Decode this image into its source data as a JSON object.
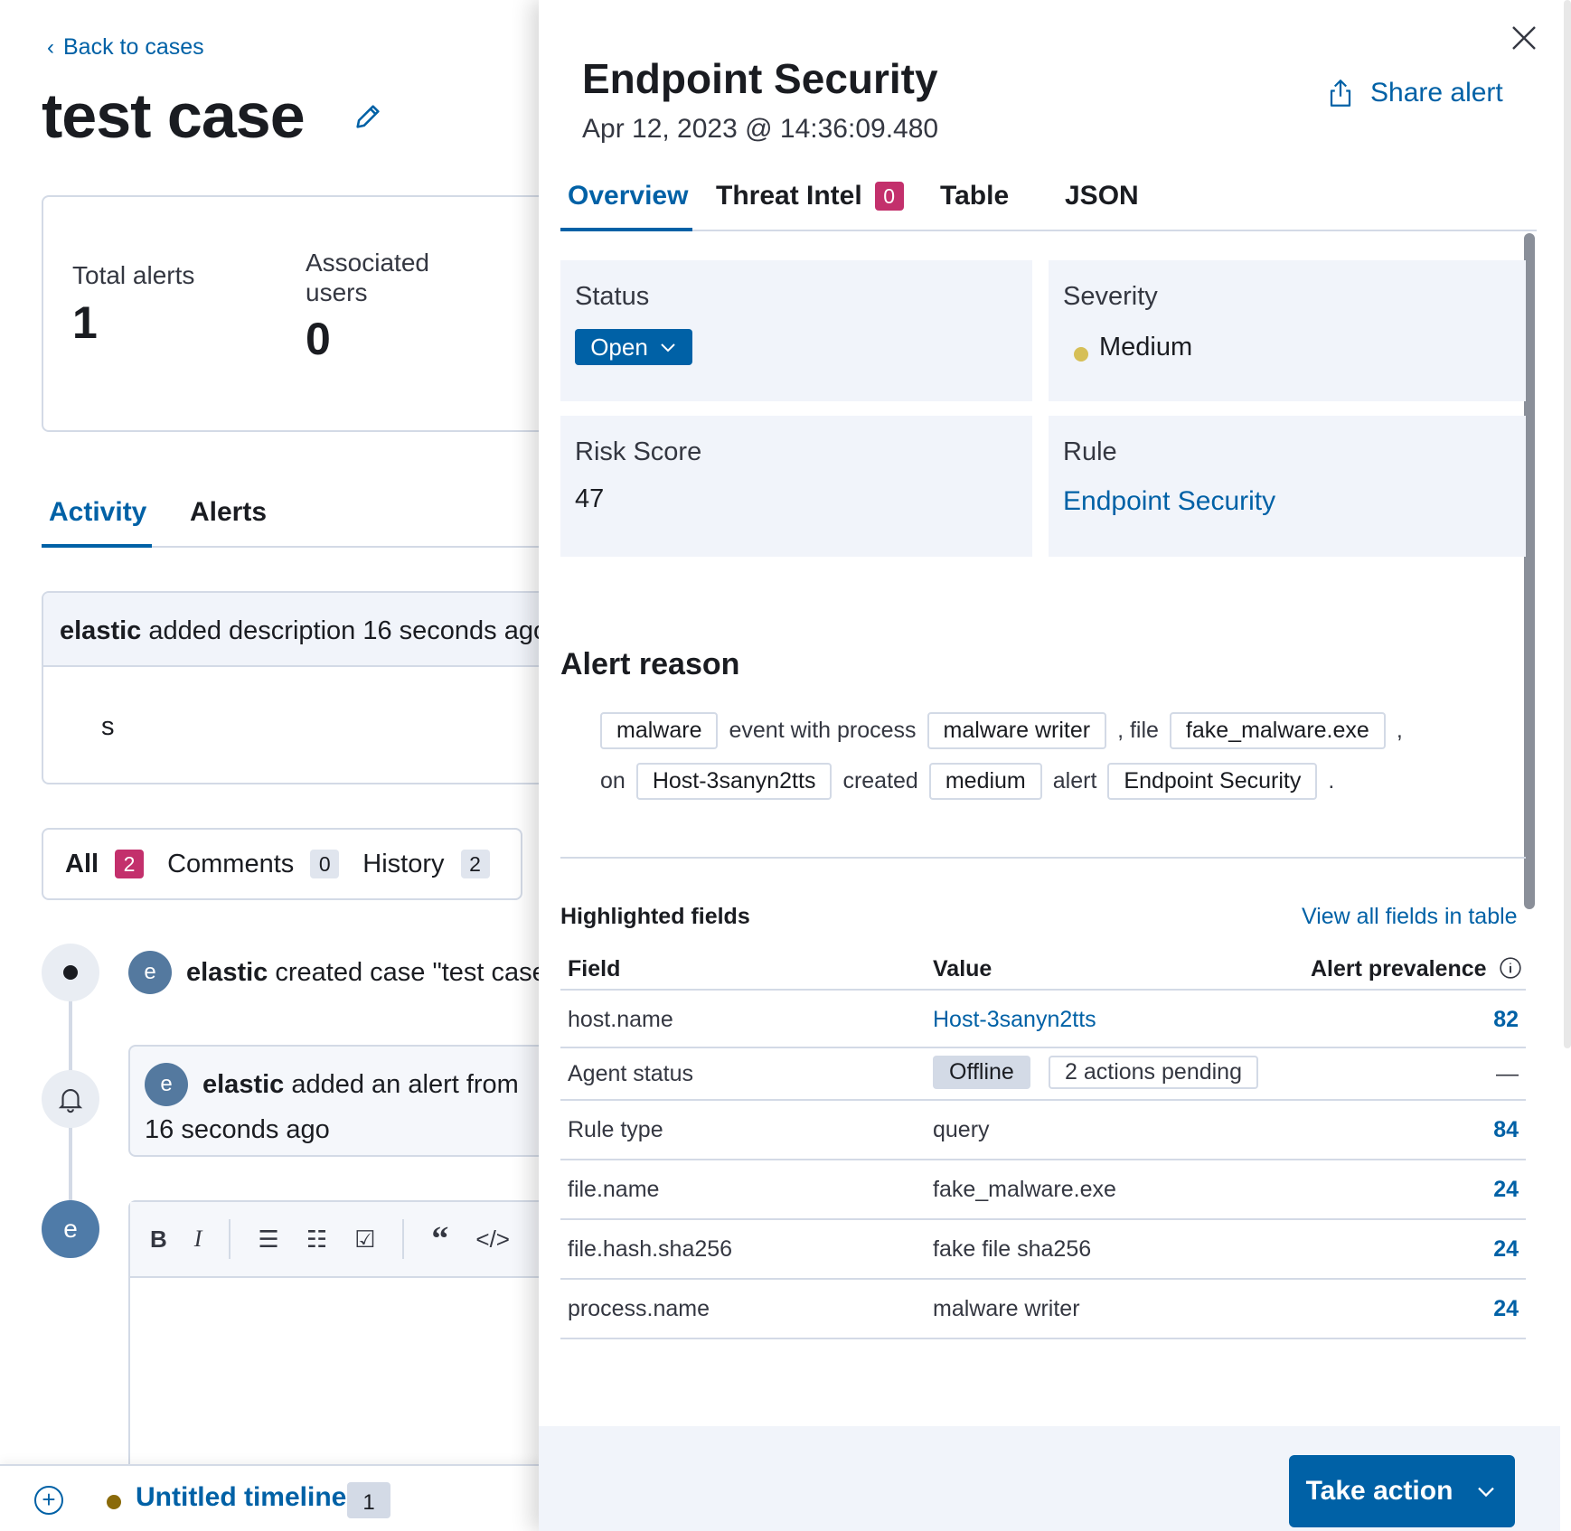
{
  "case": {
    "back_label": "Back to cases",
    "title": "test case",
    "stats": {
      "total_alerts_label": "Total alerts",
      "total_alerts_value": "1",
      "associated_users_label_1": "Associated",
      "associated_users_label_2": "users",
      "associated_users_value": "0"
    },
    "tabs": [
      "Activity",
      "Alerts"
    ],
    "description_event": {
      "user": "elastic",
      "text": " added description 16 seconds ago",
      "body": "s"
    },
    "filters": [
      {
        "label": "All",
        "count": "2"
      },
      {
        "label": "Comments",
        "count": "0"
      },
      {
        "label": "History",
        "count": "2"
      }
    ],
    "timeline_events": [
      {
        "avatar": "e",
        "user": "elastic",
        "text": " created case \"test case\""
      },
      {
        "avatar": "e",
        "user": "elastic",
        "text": " added an alert from ",
        "time": "16 seconds ago"
      }
    ],
    "composer_avatar": "e"
  },
  "timeline_bar": {
    "title": "Untitled timeline",
    "count": "1"
  },
  "flyout": {
    "title": "Endpoint Security",
    "date": "Apr 12, 2023 @ 14:36:09.480",
    "share_label": "Share alert",
    "tabs": {
      "overview": "Overview",
      "threat_intel": "Threat Intel",
      "threat_intel_count": "0",
      "table": "Table",
      "json": "JSON"
    },
    "status": {
      "label": "Status",
      "value": "Open"
    },
    "severity": {
      "label": "Severity",
      "value": "Medium",
      "color": "#d6bf57"
    },
    "risk_score": {
      "label": "Risk Score",
      "value": "47"
    },
    "rule": {
      "label": "Rule",
      "value": "Endpoint Security"
    },
    "alert_reason": {
      "title": "Alert reason",
      "line1": {
        "event_category": "malware",
        "text1": "event with process",
        "process": "malware writer",
        "text2": ", file",
        "file": "fake_malware.exe",
        "text3": ","
      },
      "line2": {
        "text1": "on",
        "host": "Host-3sanyn2tts",
        "text2": "created",
        "severity": "medium",
        "text3": "alert",
        "rule": "Endpoint Security",
        "text4": "."
      }
    },
    "highlighted": {
      "title": "Highlighted fields",
      "view_all": "View all fields in table",
      "headers": {
        "field": "Field",
        "value": "Value",
        "prevalence": "Alert prevalence"
      },
      "rows": [
        {
          "field": "host.name",
          "value": "Host-3sanyn2tts",
          "prevalence": "82"
        },
        {
          "field": "Agent status",
          "value": "Offline",
          "value2": "2 actions pending",
          "prevalence": "—"
        },
        {
          "field": "Rule type",
          "value": "query",
          "prevalence": "84"
        },
        {
          "field": "file.name",
          "value": "fake_malware.exe",
          "prevalence": "24"
        },
        {
          "field": "file.hash.sha256",
          "value": "fake file sha256",
          "prevalence": "24"
        },
        {
          "field": "process.name",
          "value": "malware writer",
          "prevalence": "24"
        }
      ]
    },
    "take_action": "Take action"
  }
}
